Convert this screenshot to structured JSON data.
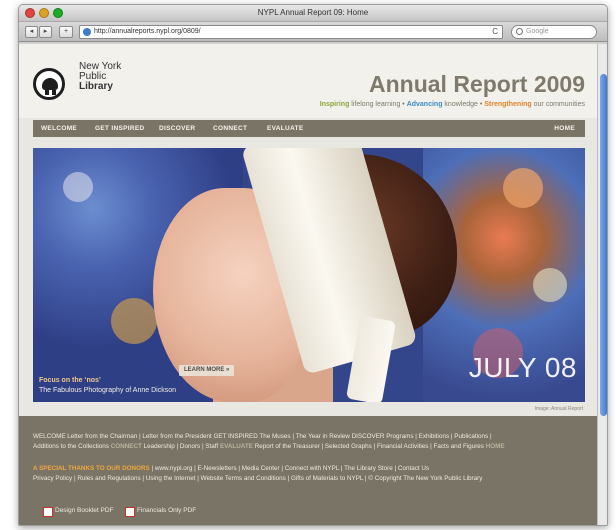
{
  "browser": {
    "window_title": "NYPL Annual Report 09: Home",
    "url": "http://annualreports.nypl.org/0809/",
    "search_placeholder": "Google",
    "back": "◂",
    "forward": "▸",
    "add": "+",
    "reload": "C"
  },
  "header": {
    "library_name_line1": "New York",
    "library_name_line2": "Public",
    "library_name_line3": "Library",
    "report_title": "Annual Report 2009",
    "tagline": {
      "w1": "Inspiring",
      "r1": " lifelong learning • ",
      "w2": "Advancing",
      "r2": " knowledge • ",
      "w3": "Strengthening",
      "r3": " our communities"
    },
    "colors": {
      "inspiring": "#8aa63d",
      "advancing": "#3b8cc5",
      "strengthening": "#e2832e"
    }
  },
  "menu": {
    "items": [
      "WELCOME",
      "GET INSPIRED",
      "DISCOVER",
      "CONNECT",
      "EVALUATE"
    ],
    "home": "HOME"
  },
  "hero": {
    "caption_title": "Focus on the ‘nos’",
    "caption_text": "The Fabulous Photography of Anne Dickson",
    "learn_more": "LEARN MORE »",
    "date": "JULY 08",
    "credit": "Image: Annual Report"
  },
  "footer": {
    "line1": "WELCOME  Letter from the Chairman | Letter from the President  GET INSPIRED  The Muses | The Year in Review  DISCOVER  Programs | Exhibitions | Publications |",
    "line2a": "Additions to the Collections",
    "line2b": "CONNECT",
    "line2c": "Leadership | Donors | Staff",
    "line2d": "EVALUATE",
    "line2e": "Report of the Treasurer | Selected Graphs | Financial Activities | Facts and Figures",
    "line2f": "HOME",
    "line3a": "A SPECIAL THANKS TO OUR DONORS",
    "line3b": "  |  www.nypl.org  |  E-Newsletters  |  Media Center  |  Connect with NYPL  |  The Library Store  |  Contact Us",
    "line4": "Privacy Policy  |  Rules and Regulations  |  Using the Internet  |  Website Terms and Conditions  |  Gifts of Materials to NYPL  |  © Copyright The New York Public Library",
    "pdf1": "Design Booklet PDF",
    "pdf2": "Financials Only PDF"
  }
}
